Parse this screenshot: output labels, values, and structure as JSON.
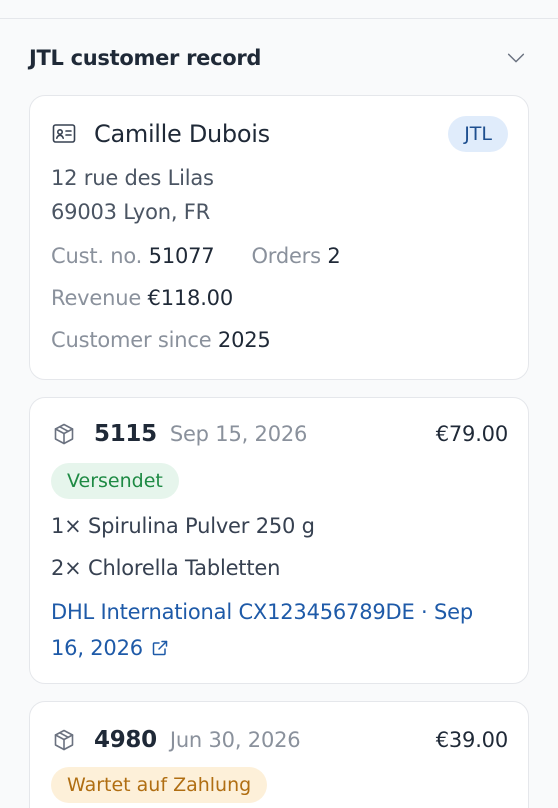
{
  "section": {
    "title": "JTL customer record"
  },
  "customer": {
    "name": "Camille Dubois",
    "source_tag": "JTL",
    "address_line1": "12 rue des Lilas",
    "address_line2": "69003 Lyon, FR",
    "cust_no_label": "Cust. no.",
    "cust_no": "51077",
    "orders_label": "Orders",
    "orders": "2",
    "revenue_label": "Revenue",
    "revenue": "€118.00",
    "since_label": "Customer since",
    "since": "2025"
  },
  "orders": [
    {
      "number": "5115",
      "date": "Sep 15, 2026",
      "total": "€79.00",
      "status": "Versendet",
      "items": [
        "1× Spirulina Pulver 250 g",
        "2× Chlorella Tabletten"
      ],
      "tracking": "DHL International CX123456789DE · Sep 16, 2026"
    },
    {
      "number": "4980",
      "date": "Jun 30, 2026",
      "total": "€39.00",
      "status": "Wartet auf Zahlung"
    }
  ],
  "icons": {
    "collapse": "chevron-down-icon",
    "customer": "id-card-icon",
    "order": "package-icon",
    "external": "external-link-icon"
  },
  "colors": {
    "tag_bg": "#e0ecfb",
    "tag_text": "#1e4f8f",
    "shipped_bg": "#e6f5ec",
    "shipped_text": "#1e8a44",
    "pending_bg": "#fdf0d9",
    "pending_text": "#b06e12",
    "link": "#1e5aa8"
  }
}
